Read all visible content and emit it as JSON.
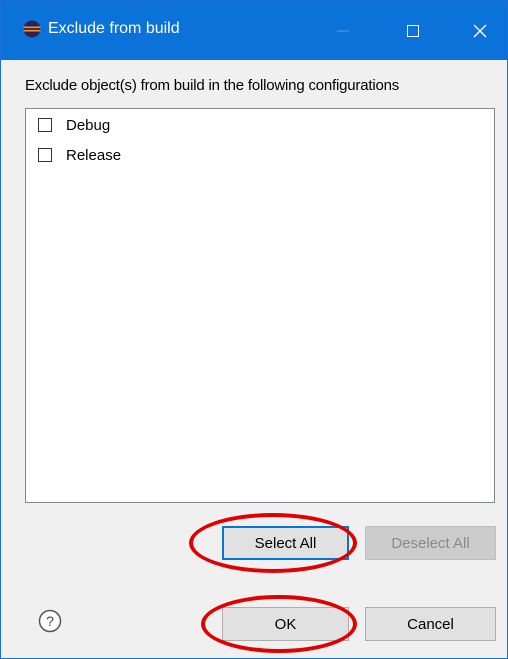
{
  "window": {
    "title": "Exclude from build",
    "controls": [
      "minimize-icon",
      "maximize-icon",
      "close-icon"
    ]
  },
  "dialog": {
    "instruction": "Exclude object(s) from build in the following configurations",
    "configurations": [
      {
        "label": "Debug",
        "checked": false
      },
      {
        "label": "Release",
        "checked": false
      }
    ]
  },
  "buttons": {
    "select_all": "Select All",
    "deselect_all": "Deselect All",
    "ok": "OK",
    "cancel": "Cancel",
    "deselect_all_enabled": false
  },
  "help": {
    "icon": "help-icon"
  },
  "annotations": {
    "highlight_color": "#e00000",
    "highlighted": [
      "select-all-button",
      "ok-button"
    ]
  },
  "colors": {
    "titlebar": "#0a72d8",
    "focus_border": "#0078d7"
  }
}
